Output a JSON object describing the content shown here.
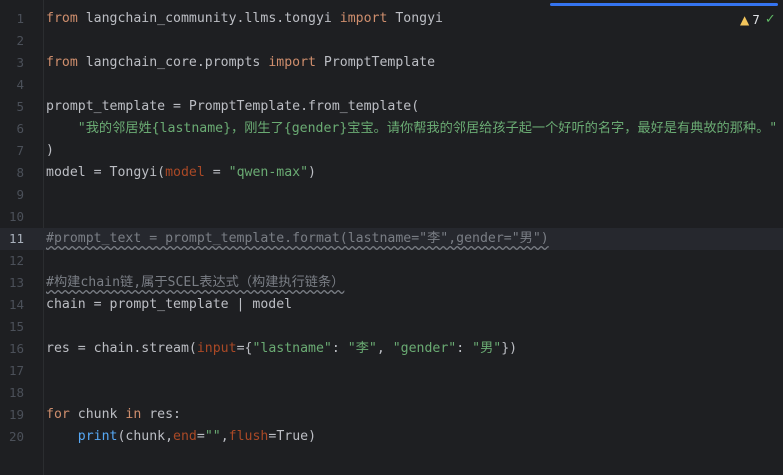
{
  "editor": {
    "warning_count": "7",
    "warning_icon": "warning-triangle-icon",
    "check_icon": "double-check-icon",
    "current_line": 11,
    "lines": [
      {
        "n": "1",
        "tokens": [
          [
            "kw",
            "from"
          ],
          [
            "t",
            " langchain_community.llms.tongyi "
          ],
          [
            "kw",
            "import"
          ],
          [
            "t",
            " Tongyi"
          ]
        ]
      },
      {
        "n": "2",
        "tokens": []
      },
      {
        "n": "3",
        "tokens": [
          [
            "kw",
            "from"
          ],
          [
            "t",
            " langchain_core.prompts "
          ],
          [
            "kw",
            "import"
          ],
          [
            "t",
            " PromptTemplate"
          ]
        ]
      },
      {
        "n": "4",
        "tokens": []
      },
      {
        "n": "5",
        "tokens": [
          [
            "t",
            "prompt_template = PromptTemplate.from_template("
          ]
        ]
      },
      {
        "n": "6",
        "tokens": [
          [
            "t",
            "    "
          ],
          [
            "str",
            "\"我的邻居姓{lastname}，刚生了{gender}宝宝。请你帮我的邻居给孩子起一个好听的名字，最好是有典故的那种。\""
          ]
        ]
      },
      {
        "n": "7",
        "tokens": [
          [
            "t",
            ")"
          ]
        ]
      },
      {
        "n": "8",
        "tokens": [
          [
            "t",
            "model = Tongyi("
          ],
          [
            "param",
            "model"
          ],
          [
            "t",
            " = "
          ],
          [
            "str",
            "\"qwen-max\""
          ],
          [
            "t",
            ")"
          ]
        ]
      },
      {
        "n": "9",
        "tokens": []
      },
      {
        "n": "10",
        "tokens": []
      },
      {
        "n": "11",
        "tokens": [
          [
            "cmtw",
            "#prompt_text = prompt_template.format(lastname=\"李\",gender=\"男\")"
          ]
        ]
      },
      {
        "n": "12",
        "tokens": []
      },
      {
        "n": "13",
        "tokens": [
          [
            "cmtw",
            "#构建chain链,属于SCEL表达式（构建执行链条）"
          ]
        ]
      },
      {
        "n": "14",
        "tokens": [
          [
            "t",
            "chain = prompt_template | model"
          ]
        ]
      },
      {
        "n": "15",
        "tokens": []
      },
      {
        "n": "16",
        "tokens": [
          [
            "t",
            "res = chain.stream("
          ],
          [
            "param",
            "input"
          ],
          [
            "t",
            "={"
          ],
          [
            "str",
            "\"lastname\""
          ],
          [
            "t",
            ": "
          ],
          [
            "str",
            "\"李\""
          ],
          [
            "t",
            ", "
          ],
          [
            "str",
            "\"gender\""
          ],
          [
            "t",
            ": "
          ],
          [
            "str",
            "\"男\""
          ],
          [
            "t",
            "})"
          ]
        ]
      },
      {
        "n": "17",
        "tokens": []
      },
      {
        "n": "18",
        "tokens": []
      },
      {
        "n": "19",
        "tokens": [
          [
            "kw",
            "for"
          ],
          [
            "t",
            " chunk "
          ],
          [
            "kw",
            "in"
          ],
          [
            "t",
            " res:"
          ]
        ]
      },
      {
        "n": "20",
        "tokens": [
          [
            "t",
            "    "
          ],
          [
            "fn",
            "print"
          ],
          [
            "t",
            "(chunk,"
          ],
          [
            "param",
            "end"
          ],
          [
            "t",
            "="
          ],
          [
            "str",
            "\"\""
          ],
          [
            "t",
            ","
          ],
          [
            "param",
            "flush"
          ],
          [
            "t",
            "=True)"
          ]
        ]
      }
    ]
  }
}
